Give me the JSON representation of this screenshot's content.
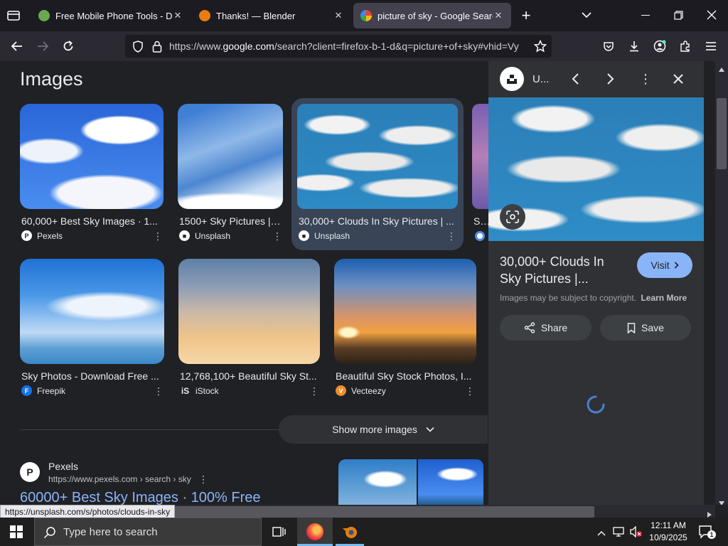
{
  "tabs": [
    {
      "title": "Free Mobile Phone Tools - Dow",
      "close": "✕"
    },
    {
      "title": "Thanks! — Blender",
      "close": "✕"
    },
    {
      "title": "picture of sky - Google Search",
      "close": "✕"
    }
  ],
  "toolbar": {
    "new_tab": "+",
    "url_prefix": "https://www.",
    "url_domain": "google.com",
    "url_rest": "/search?client=firefox-b-1-d&q=picture+of+sky#vhid=Vy"
  },
  "results": {
    "heading": "Images",
    "images": [
      {
        "caption": "60,000+ Best Sky Images · 1...",
        "source": "Pexels"
      },
      {
        "caption": "1500+ Sky Pictures | ...",
        "source": "Unsplash"
      },
      {
        "caption": "30,000+ Clouds In Sky Pictures | ...",
        "source": "Unsplash"
      },
      {
        "caption": "Sky",
        "source": ""
      },
      {
        "caption": "Sky Photos - Download Free ...",
        "source": "Freepik"
      },
      {
        "caption": "12,768,100+ Beautiful Sky St...",
        "source": "iStock"
      },
      {
        "caption": "Beautiful Sky Stock Photos, I...",
        "source": "Vecteezy"
      }
    ],
    "show_more": "Show more images",
    "web_result": {
      "site": "Pexels",
      "url": "https://www.pexels.com › search › sky",
      "title": "60000+ Best Sky Images · 100% Free"
    }
  },
  "panel": {
    "source_short": "U...",
    "title": "30,000+ Clouds In Sky Pictures |...",
    "visit": "Visit",
    "copyright": "Images may be subject to copyright.",
    "learn_more": "Learn More",
    "share": "Share",
    "save": "Save"
  },
  "status_link": "https://unsplash.com/s/photos/clouds-in-sky",
  "taskbar": {
    "search_placeholder": "Type here to search",
    "time": "12:11 AM",
    "date": "10/9/2025",
    "notifications": "1"
  },
  "colors": {
    "accent": "#8ab4f8",
    "selected_card": "#394457",
    "panel_bg": "#303134"
  }
}
